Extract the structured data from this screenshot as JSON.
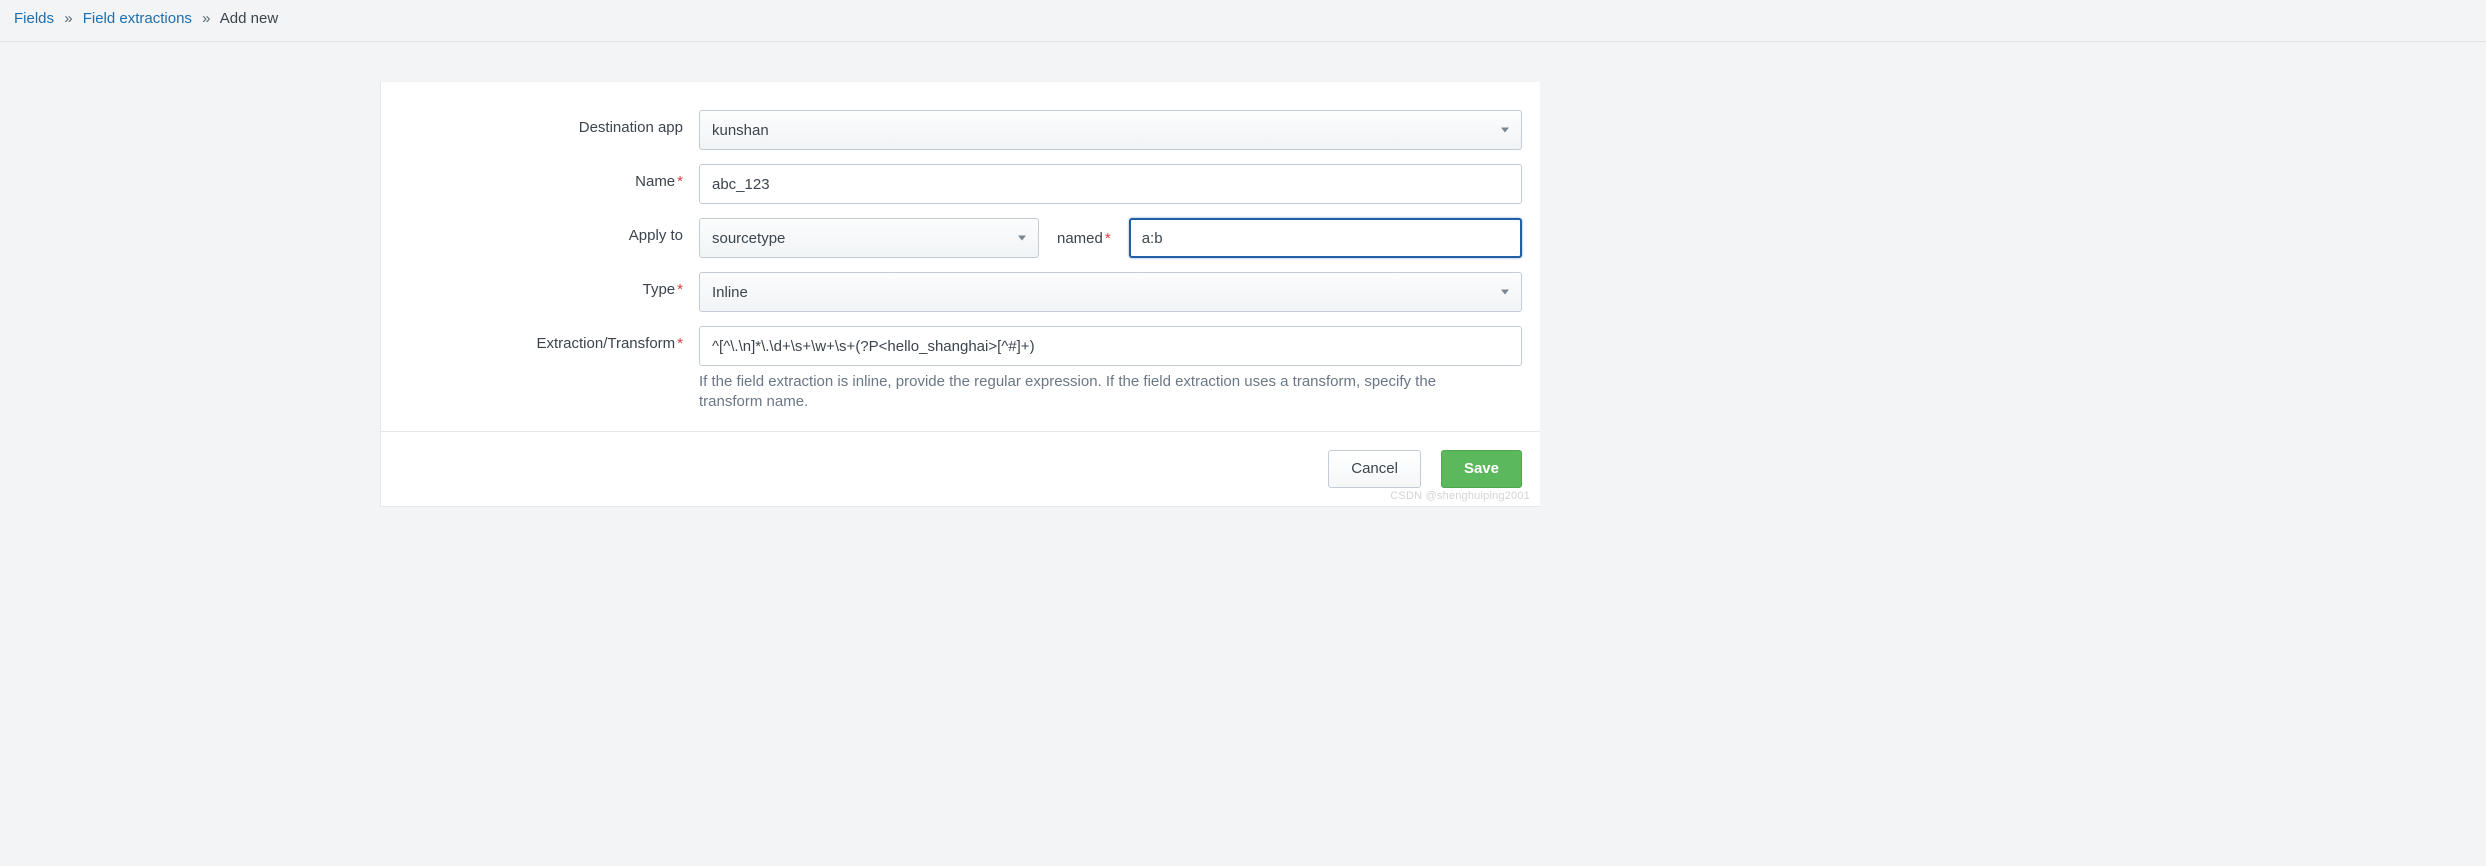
{
  "breadcrumb": {
    "fields": "Fields",
    "extractions": "Field extractions",
    "current": "Add new",
    "sep": "»"
  },
  "labels": {
    "destination_app": "Destination app",
    "name": "Name",
    "apply_to": "Apply to",
    "named": "named",
    "type": "Type",
    "extraction": "Extraction/Transform"
  },
  "values": {
    "destination_app": "kunshan",
    "name": "abc_123",
    "apply_to": "sourcetype",
    "named": "a:b",
    "type": "Inline",
    "extraction": "^[^\\.\\n]*\\.\\d+\\s+\\w+\\s+(?P<hello_shanghai>[^#]+)"
  },
  "help": {
    "extraction": "If the field extraction is inline, provide the regular expression. If the field extraction uses a transform, specify the transform name."
  },
  "buttons": {
    "cancel": "Cancel",
    "save": "Save"
  },
  "watermark": "CSDN @shenghuiping2001"
}
